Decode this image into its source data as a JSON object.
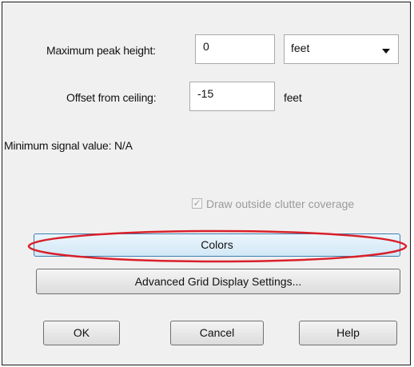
{
  "form": {
    "max_peak_label": "Maximum peak height:",
    "max_peak_value": "0",
    "max_peak_unit": "feet",
    "offset_label": "Offset from ceiling:",
    "offset_value": "-15",
    "offset_unit": "feet",
    "min_signal_label": "Minimum signal value: N/A",
    "draw_outside_label": "Draw outside clutter coverage",
    "draw_outside_checked": true
  },
  "buttons": {
    "colors": "Colors",
    "advanced": "Advanced Grid Display Settings...",
    "ok": "OK",
    "cancel": "Cancel",
    "help": "Help"
  },
  "colors": {
    "highlight_ellipse": "#d9202a",
    "focus_border": "#3c7fb1"
  }
}
